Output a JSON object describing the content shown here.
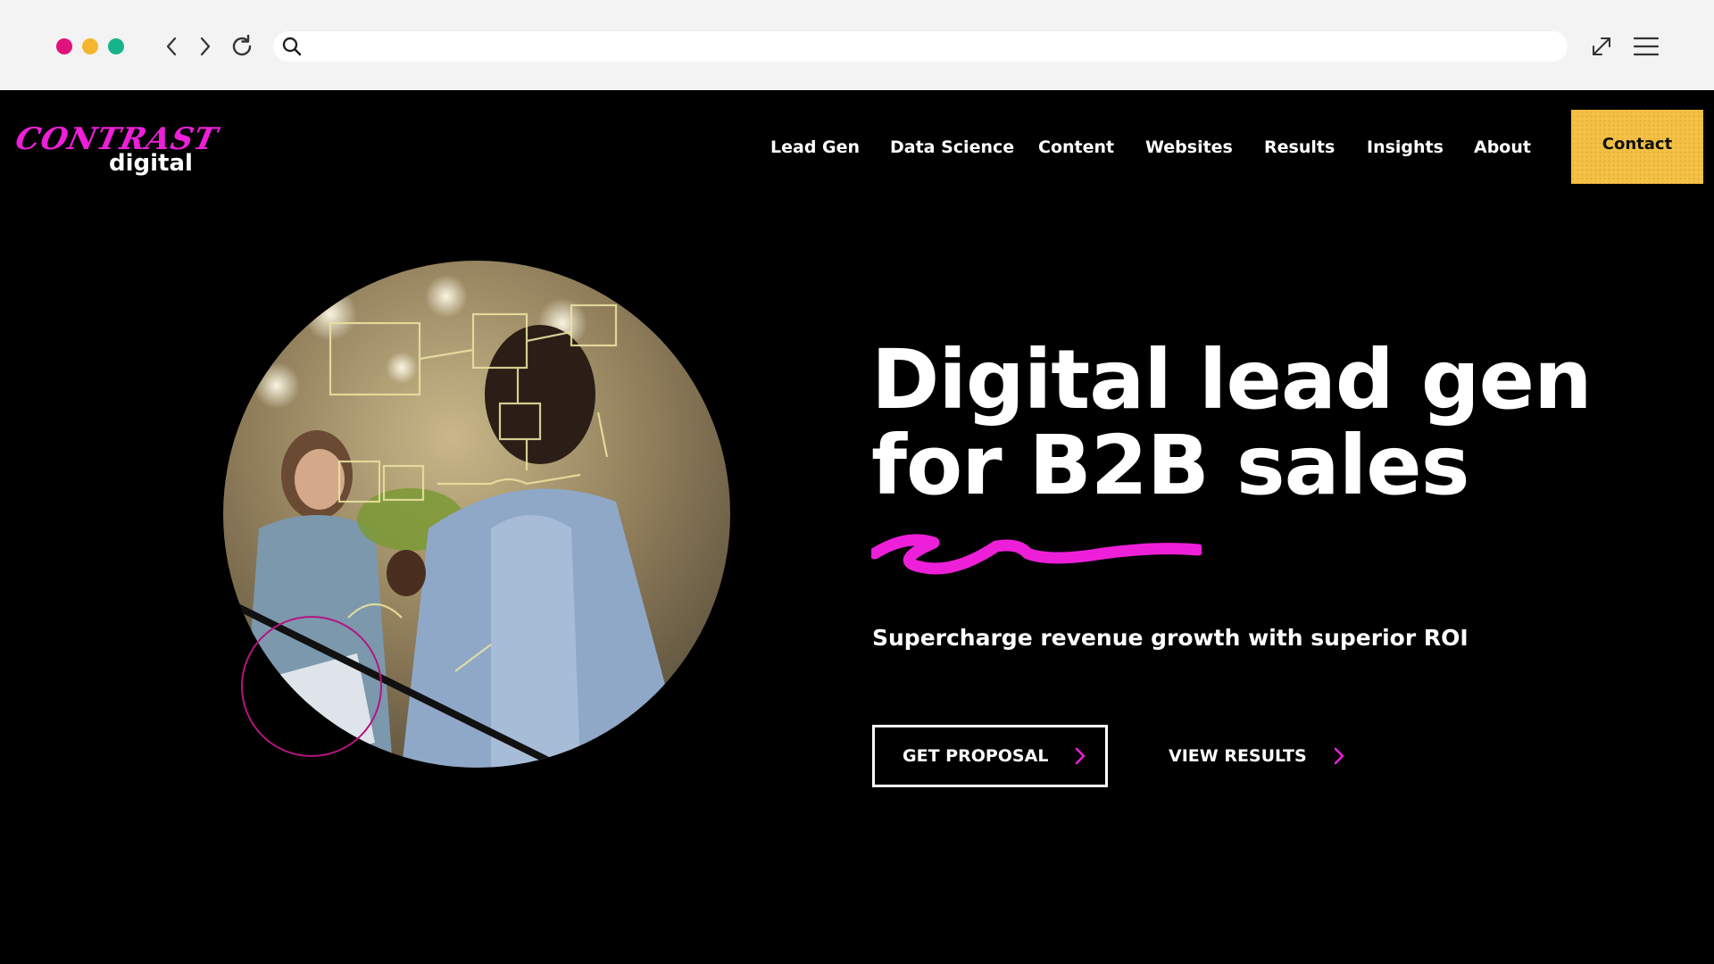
{
  "browser": {
    "traffic_lights": {
      "close": "#e0127b",
      "minimize": "#f5b52c",
      "maximize": "#17b38c"
    },
    "icons": {
      "back": "chevron-left-icon",
      "forward": "chevron-right-icon",
      "reload": "reload-icon",
      "search": "search-icon",
      "expand": "expand-icon",
      "menu": "hamburger-menu-icon"
    },
    "url_value": ""
  },
  "logo": {
    "line1": "CONTRAST",
    "line2": "digital"
  },
  "nav": {
    "items": [
      {
        "label": "Lead Gen"
      },
      {
        "label": "Data Science"
      },
      {
        "label": "Content"
      },
      {
        "label": "Websites"
      },
      {
        "label": "Results"
      },
      {
        "label": "Insights"
      },
      {
        "label": "About"
      }
    ],
    "contact_label": "Contact"
  },
  "hero": {
    "headline_line1": "Digital lead gen",
    "headline_line2": "for B2B sales",
    "subhead": "Supercharge revenue growth with superior ROI",
    "primary_button": "GET PROPOSAL",
    "secondary_button": "VIEW RESULTS"
  },
  "colors": {
    "accent_magenta": "#ee1fd8",
    "contact_yellow": "#f4c145",
    "background": "#000000",
    "text": "#ffffff"
  }
}
